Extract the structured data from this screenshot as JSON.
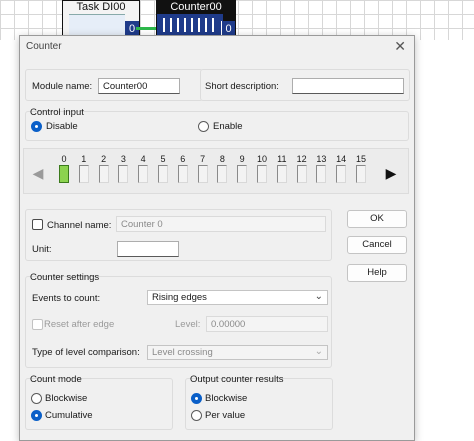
{
  "diagram": {
    "task_block_title": "Task DI00",
    "task_port": "0",
    "counter_block_title": "Counter00",
    "counter_port": "0"
  },
  "dialog": {
    "title": "Counter",
    "module_name_label": "Module name:",
    "module_name_value": "Counter00",
    "short_description_label": "Short description:",
    "short_description_value": "",
    "control_input": {
      "title": "Control input",
      "disable_label": "Disable",
      "enable_label": "Enable",
      "selected": "Disable"
    },
    "channels": [
      "0",
      "1",
      "2",
      "3",
      "4",
      "5",
      "6",
      "7",
      "8",
      "9",
      "10",
      "11",
      "12",
      "13",
      "14",
      "15"
    ],
    "active_channel": "0",
    "channel_name_label": "Channel name:",
    "channel_name_placeholder": "Counter 0",
    "unit_label": "Unit:",
    "unit_value": "",
    "counter_settings": {
      "title": "Counter settings",
      "events_label": "Events to count:",
      "events_value": "Rising edges",
      "reset_label": "Reset after edge",
      "level_label": "Level:",
      "level_value": "0.00000",
      "level_type_label": "Type of level comparison:",
      "level_type_value": "Level crossing"
    },
    "count_mode": {
      "title": "Count mode",
      "blockwise_label": "Blockwise",
      "cumulative_label": "Cumulative",
      "selected": "Cumulative"
    },
    "output_results": {
      "title": "Output counter results",
      "blockwise_label": "Blockwise",
      "per_value_label": "Per value",
      "selected": "Blockwise"
    },
    "buttons": {
      "ok": "OK",
      "cancel": "Cancel",
      "help": "Help"
    }
  },
  "colors": {
    "accent": "#0a5fc8",
    "active_channel": "#8cd34f",
    "wire": "#2db84b",
    "block_port": "#1f3b8a"
  }
}
